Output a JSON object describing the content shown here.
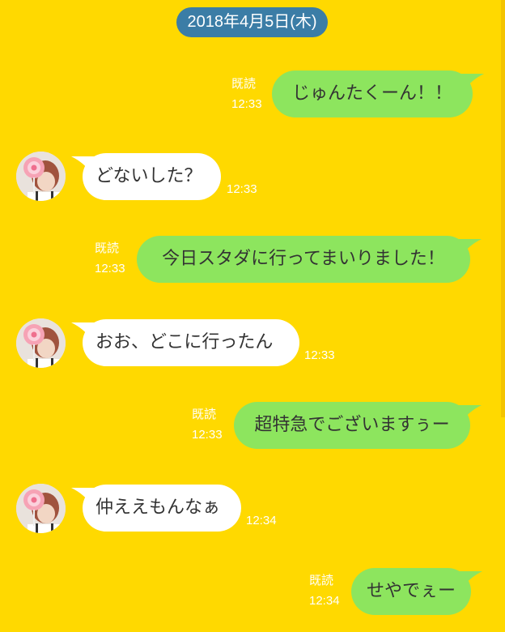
{
  "chat": {
    "date_label": "2018年4月5日(木)",
    "read_label": "既読",
    "colors": {
      "background": "#FFD900",
      "sent_bubble": "#8DE55E",
      "received_bubble": "#FFFFFF",
      "date_pill": "#3B7DA6"
    },
    "messages": [
      {
        "direction": "sent",
        "text": "じゅんたくーん！！",
        "time": "12:33",
        "read": "既読"
      },
      {
        "direction": "received",
        "text": "どないした？",
        "time": "12:33"
      },
      {
        "direction": "sent",
        "text": "今日スタダに行ってまいりました！",
        "time": "12:33",
        "read": "既読"
      },
      {
        "direction": "received",
        "text": "おお、どこに行ったん",
        "time": "12:33"
      },
      {
        "direction": "sent",
        "text": "超特急でございますぅー",
        "time": "12:33",
        "read": "既読"
      },
      {
        "direction": "received",
        "text": "仲ええもんなぁ",
        "time": "12:34"
      },
      {
        "direction": "sent",
        "text": "せやでぇー",
        "time": "12:34",
        "read": "既読"
      }
    ]
  }
}
